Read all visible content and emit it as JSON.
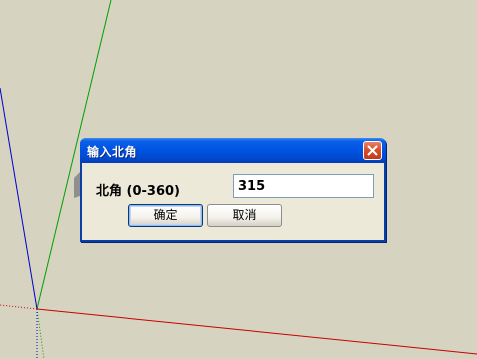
{
  "dialog": {
    "title": "输入北角",
    "field_label": "北角 (0-360)",
    "field_value": "315",
    "ok_label": "确定",
    "cancel_label": "取消"
  },
  "colors": {
    "canvas_background": "#d6d3c1",
    "green_axis": "#00a000",
    "blue_axis": "#0000c8",
    "red_axis": "#c80000",
    "titlebar_blue": "#0054e3",
    "close_red": "#d7502e"
  },
  "icons": {
    "close": "close-icon"
  }
}
